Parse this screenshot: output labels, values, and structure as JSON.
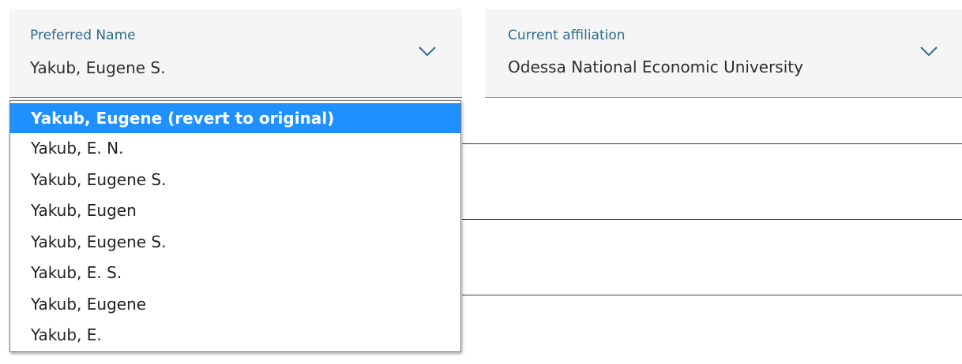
{
  "preferred_name": {
    "label": "Preferred Name",
    "value": "Yakub, Eugene S."
  },
  "current_affiliation": {
    "label": "Current affiliation",
    "value": "Odessa National Economic University"
  },
  "dropdown": {
    "options": [
      "Yakub, Eugene (revert to original)",
      "Yakub, E. N.",
      "Yakub, Eugene S.",
      "Yakub, Eugen",
      "Yakub, Eugene S.",
      "Yakub, E. S.",
      "Yakub, Eugene",
      "Yakub, E."
    ],
    "highlighted_index": 0
  },
  "colors": {
    "field_background": "#f5f5f5",
    "label": "#2e6b8a",
    "chevron": "#2e6b8a",
    "highlight": "#1e90ff"
  },
  "icons": {
    "dropdown_toggle": "chevron-down-icon"
  }
}
